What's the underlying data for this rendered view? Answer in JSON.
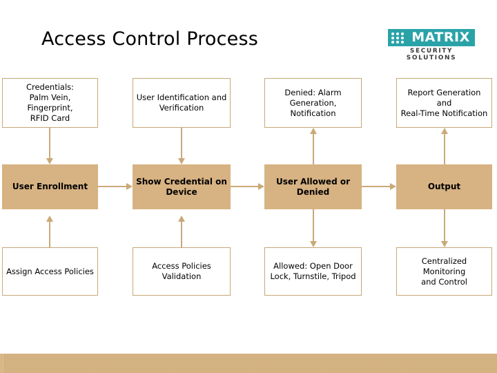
{
  "slide": {
    "title": "Access Control Process",
    "background_color": "#ffffff",
    "band_color": "#dcb987",
    "box_border_color": "#c6a777",
    "box_fill_color": "#d7b282",
    "connector_color": "#c9a978"
  },
  "logo": {
    "word": "MATRIX",
    "tagline": "SECURITY SOLUTIONS",
    "brand_color": "#2aa3a8"
  },
  "diagram": {
    "top_row": [
      {
        "label": "Credentials:\nPalm Vein, Fingerprint,\nRFID Card"
      },
      {
        "label": "User Identification and\nVerification"
      },
      {
        "label": "Denied: Alarm\nGeneration,\nNotification"
      },
      {
        "label": "Report Generation and\nReal-Time Notification"
      }
    ],
    "middle_row": [
      {
        "label": "User Enrollment"
      },
      {
        "label": "Show Credential on\nDevice"
      },
      {
        "label": "User Allowed or\nDenied"
      },
      {
        "label": "Output"
      }
    ],
    "bottom_row": [
      {
        "label": "Assign Access Policies"
      },
      {
        "label": "Access Policies\nValidation"
      },
      {
        "label": "Allowed: Open Door\nLock, Turnstile, Tripod"
      },
      {
        "label": "Centralized Monitoring\nand Control"
      }
    ]
  }
}
